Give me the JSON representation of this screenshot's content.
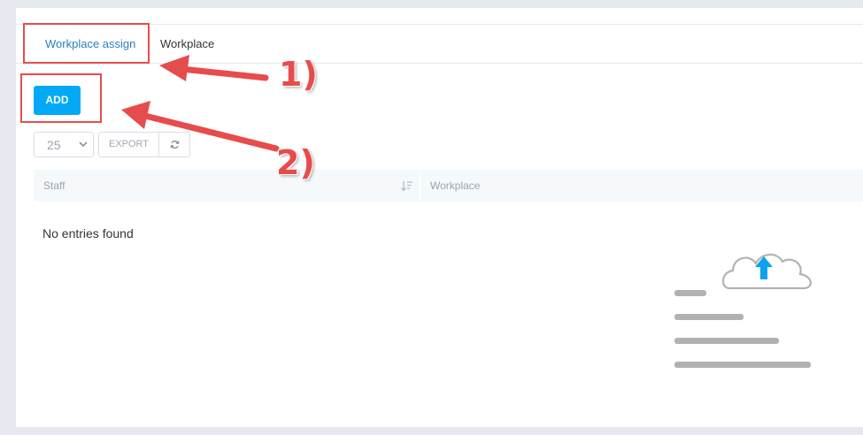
{
  "tabs": [
    {
      "label": "Workplace assign",
      "active": true
    },
    {
      "label": "Workplace",
      "active": false
    }
  ],
  "toolbar": {
    "add_label": "ADD",
    "page_length": "25",
    "export_label": "EXPORT",
    "refresh_icon": "refresh-icon"
  },
  "table": {
    "columns": [
      "Staff",
      "Workplace"
    ],
    "empty_message": "No entries found"
  },
  "annotations": {
    "label_1": "1)",
    "label_2": "2)"
  },
  "colors": {
    "accent": "#03a9f4",
    "tab_active": "#2c7ec0",
    "annotation": "#e74c4c",
    "upload_arrow": "#0aa3f0"
  }
}
